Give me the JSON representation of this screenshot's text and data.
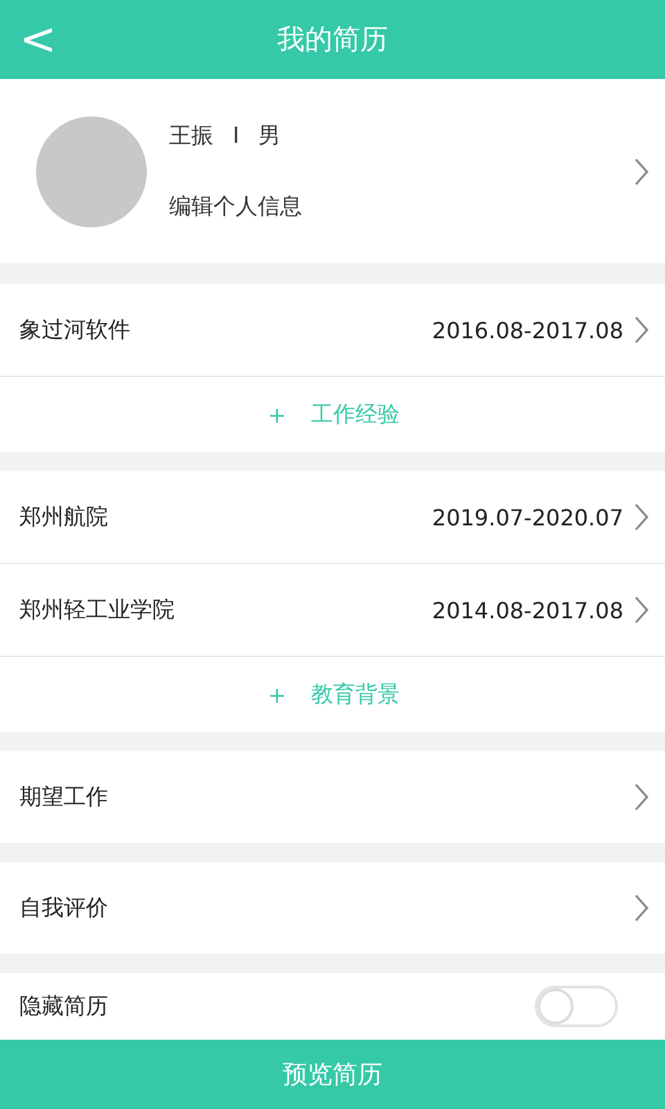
{
  "header": {
    "back": "<",
    "title": "我的简历"
  },
  "profile": {
    "name": "王振",
    "separator": "I",
    "gender": "男",
    "edit_label": "编辑个人信息"
  },
  "sections": [
    {
      "rows": [
        {
          "kind": "entry",
          "label": "象过河软件",
          "dates": "2016.08-2017.08"
        },
        {
          "kind": "add",
          "plus": "+",
          "label": "工作经验"
        }
      ]
    },
    {
      "rows": [
        {
          "kind": "entry",
          "label": "郑州航院",
          "dates": "2019.07-2020.07"
        },
        {
          "kind": "entry",
          "label": "郑州轻工业学院",
          "dates": "2014.08-2017.08"
        },
        {
          "kind": "add",
          "plus": "+",
          "label": "教育背景"
        }
      ]
    },
    {
      "rows": [
        {
          "kind": "entry",
          "label": "期望工作"
        }
      ]
    },
    {
      "rows": [
        {
          "kind": "entry",
          "label": "自我评价"
        }
      ]
    },
    {
      "rows": [
        {
          "kind": "toggle",
          "label": "隐藏简历",
          "on": false
        }
      ]
    }
  ],
  "bottom_button": "预览简历"
}
